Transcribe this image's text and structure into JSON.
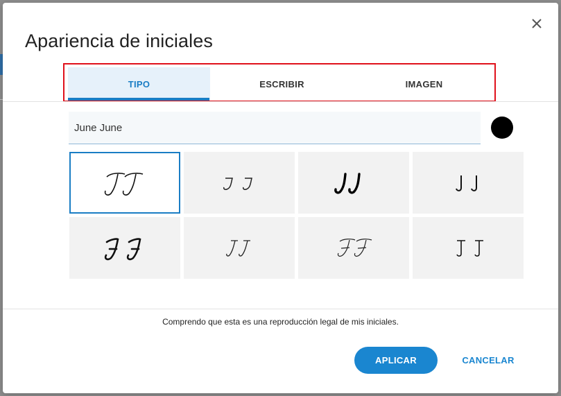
{
  "dialog": {
    "title": "Apariencia de iniciales",
    "close_icon": "close-icon"
  },
  "tabs": [
    {
      "label": "TIPO",
      "active": true
    },
    {
      "label": "ESCRIBIR",
      "active": false
    },
    {
      "label": "IMAGEN",
      "active": false
    }
  ],
  "name_input": {
    "value": "June June"
  },
  "color": {
    "selected": "#000000"
  },
  "styles": [
    {
      "initials": "JJ",
      "selected": true
    },
    {
      "initials": "JJ",
      "selected": false
    },
    {
      "initials": "JJ",
      "selected": false
    },
    {
      "initials": "JJ",
      "selected": false
    },
    {
      "initials": "JJ",
      "selected": false
    },
    {
      "initials": "JJ",
      "selected": false
    },
    {
      "initials": "JJ",
      "selected": false
    },
    {
      "initials": "JJ",
      "selected": false
    }
  ],
  "footer": {
    "legal_text": "Comprendo que esta es una reproducción legal de mis iniciales.",
    "apply_label": "APLICAR",
    "cancel_label": "CANCELAR"
  },
  "colors": {
    "accent": "#1a86d0",
    "highlight_border": "#e0101a"
  }
}
